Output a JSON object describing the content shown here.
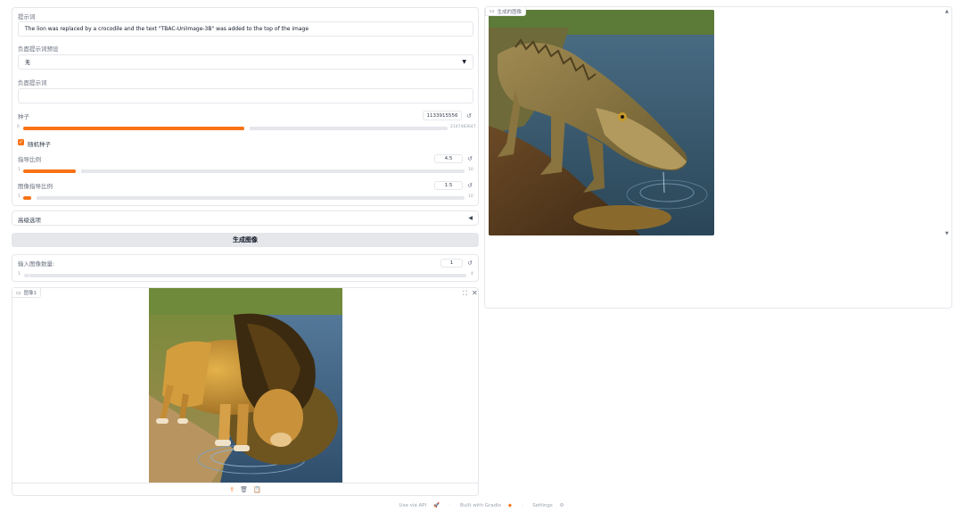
{
  "prompt": {
    "label": "提示词",
    "value": "The lion was replaced by a crocodile and the text \"TBAC-UniImage-3B\" was added to the top of the image"
  },
  "negative_preset": {
    "label": "负面提示词预设",
    "selected": "无"
  },
  "negative_prompt": {
    "label": "负面提示词",
    "value": ""
  },
  "seed": {
    "label": "种子",
    "value": "1133915556",
    "min": "0",
    "max": "2147483647",
    "fraction": 0.5
  },
  "random_seed": {
    "label": "随机种子",
    "checked": true
  },
  "guidance": {
    "label": "指导比例",
    "value": "4.5",
    "min": "1",
    "max": "10",
    "fraction": 0.12
  },
  "image_guidance": {
    "label": "图像指导比例",
    "value": "1.5",
    "min": "1",
    "max": "10",
    "fraction": 0.015
  },
  "advanced": {
    "label": "高级选项"
  },
  "generate_button": {
    "label": "生成图像"
  },
  "num_images": {
    "label": "输入图像数量:",
    "value": "1",
    "min": "1",
    "max": "4"
  },
  "input_image": {
    "badge": "图像1"
  },
  "output_image": {
    "badge": "生成的图像"
  },
  "footer": {
    "api": "Use via API",
    "gradio": "Built with Gradio",
    "settings": "Settings"
  },
  "colors": {
    "accent": "#f97316",
    "border": "#e5e7eb",
    "button_bg": "#e5e7eb"
  },
  "icons": [
    "reset-icon",
    "dropdown-arrow-icon",
    "checkbox-icon",
    "collapse-arrow-icon",
    "image-icon",
    "fullscreen-icon",
    "close-icon",
    "upload-icon",
    "delete-icon",
    "clipboard-icon",
    "scroll-up-icon",
    "scroll-down-icon",
    "rocket-icon",
    "gradio-logo-icon",
    "gear-icon"
  ]
}
